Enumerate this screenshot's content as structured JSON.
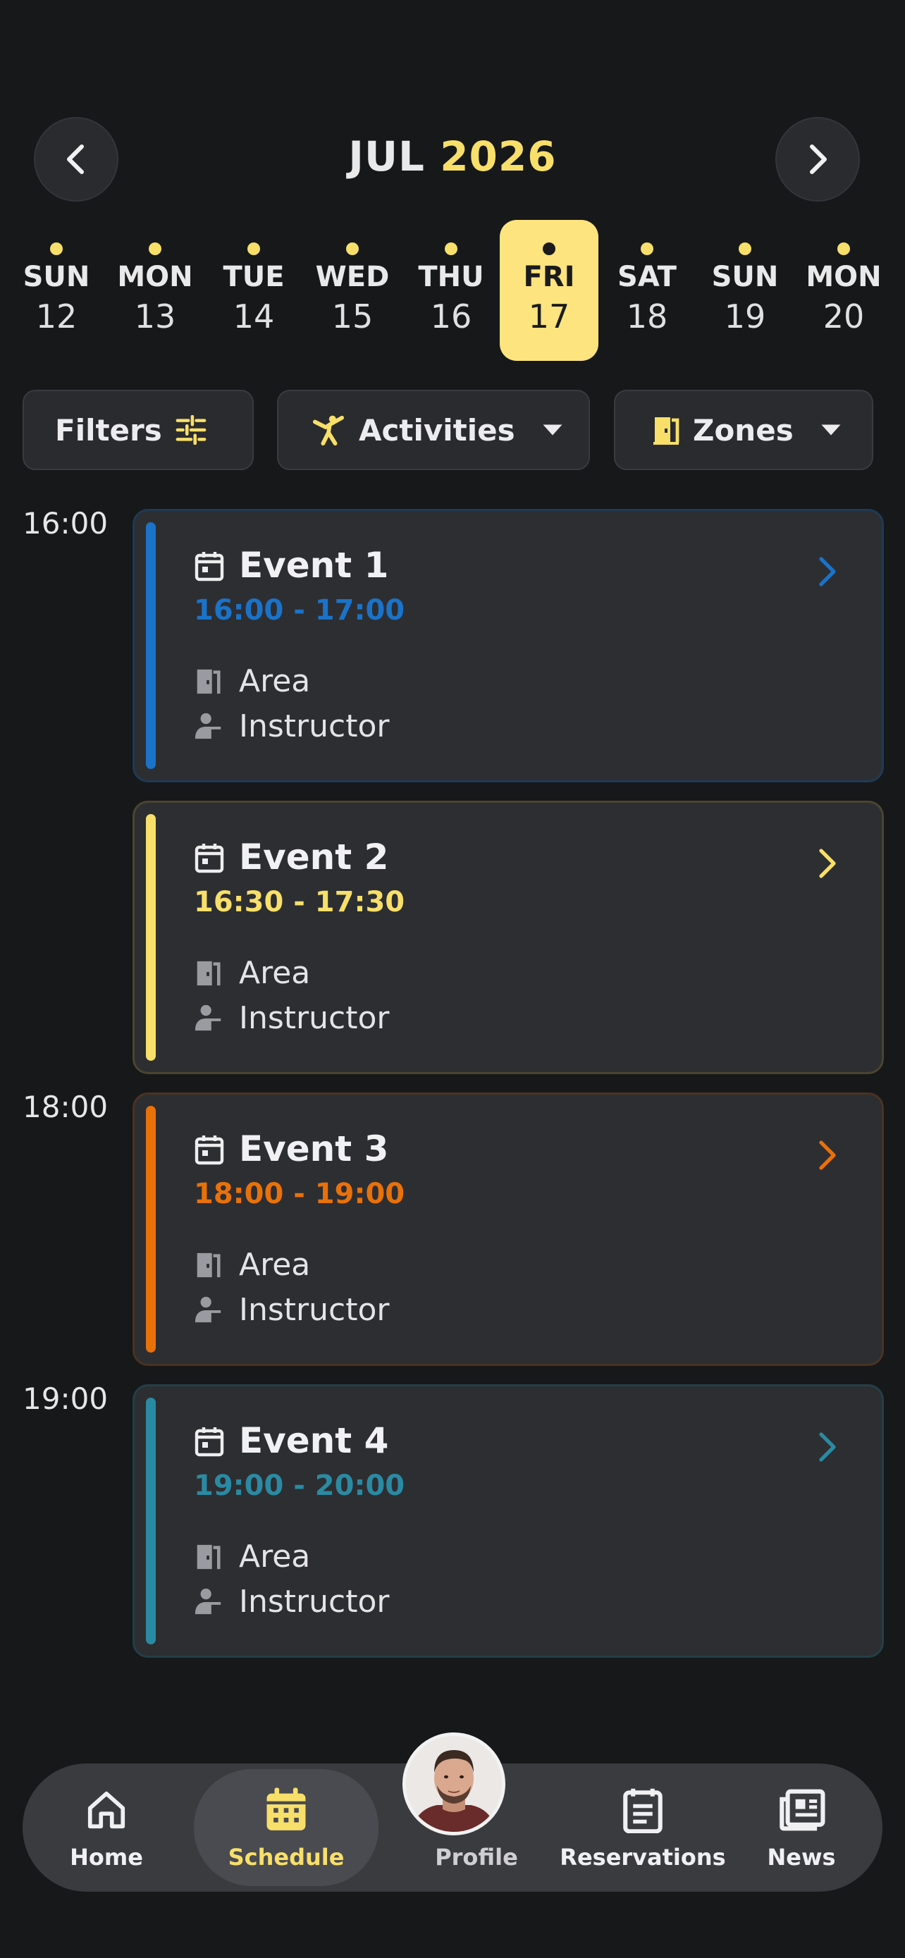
{
  "header": {
    "month": "JUL",
    "year": "2026",
    "prev_icon": "chevron-left-icon",
    "next_icon": "chevron-right-icon"
  },
  "days": [
    {
      "dow": "SUN",
      "num": "12",
      "active": false
    },
    {
      "dow": "MON",
      "num": "13",
      "active": false
    },
    {
      "dow": "TUE",
      "num": "14",
      "active": false
    },
    {
      "dow": "WED",
      "num": "15",
      "active": false
    },
    {
      "dow": "THU",
      "num": "16",
      "active": false
    },
    {
      "dow": "FRI",
      "num": "17",
      "active": true
    },
    {
      "dow": "SAT",
      "num": "18",
      "active": false
    },
    {
      "dow": "SUN",
      "num": "19",
      "active": false
    },
    {
      "dow": "MON",
      "num": "20",
      "active": false
    }
  ],
  "filters": {
    "filters_label": "Filters",
    "activities_label": "Activities",
    "zones_label": "Zones"
  },
  "time_labels": [
    "16:00",
    "18:00",
    "19:00"
  ],
  "events": [
    {
      "title": "Event 1",
      "time": "16:00 - 17:00",
      "area": "Area",
      "instructor": "Instructor",
      "color": "#1a73c9"
    },
    {
      "title": "Event 2",
      "time": "16:30 - 17:30",
      "area": "Area",
      "instructor": "Instructor",
      "color": "#f7df6a"
    },
    {
      "title": "Event 3",
      "time": "18:00 - 19:00",
      "area": "Area",
      "instructor": "Instructor",
      "color": "#e8710a"
    },
    {
      "title": "Event 4",
      "time": "19:00 - 20:00",
      "area": "Area",
      "instructor": "Instructor",
      "color": "#2a8aa3"
    }
  ],
  "nav": {
    "home": "Home",
    "schedule": "Schedule",
    "profile": "Profile",
    "reservations": "Reservations",
    "news": "News"
  },
  "colors": {
    "accent": "#f7df6a",
    "background": "#17181a",
    "card": "#2d2e32"
  }
}
